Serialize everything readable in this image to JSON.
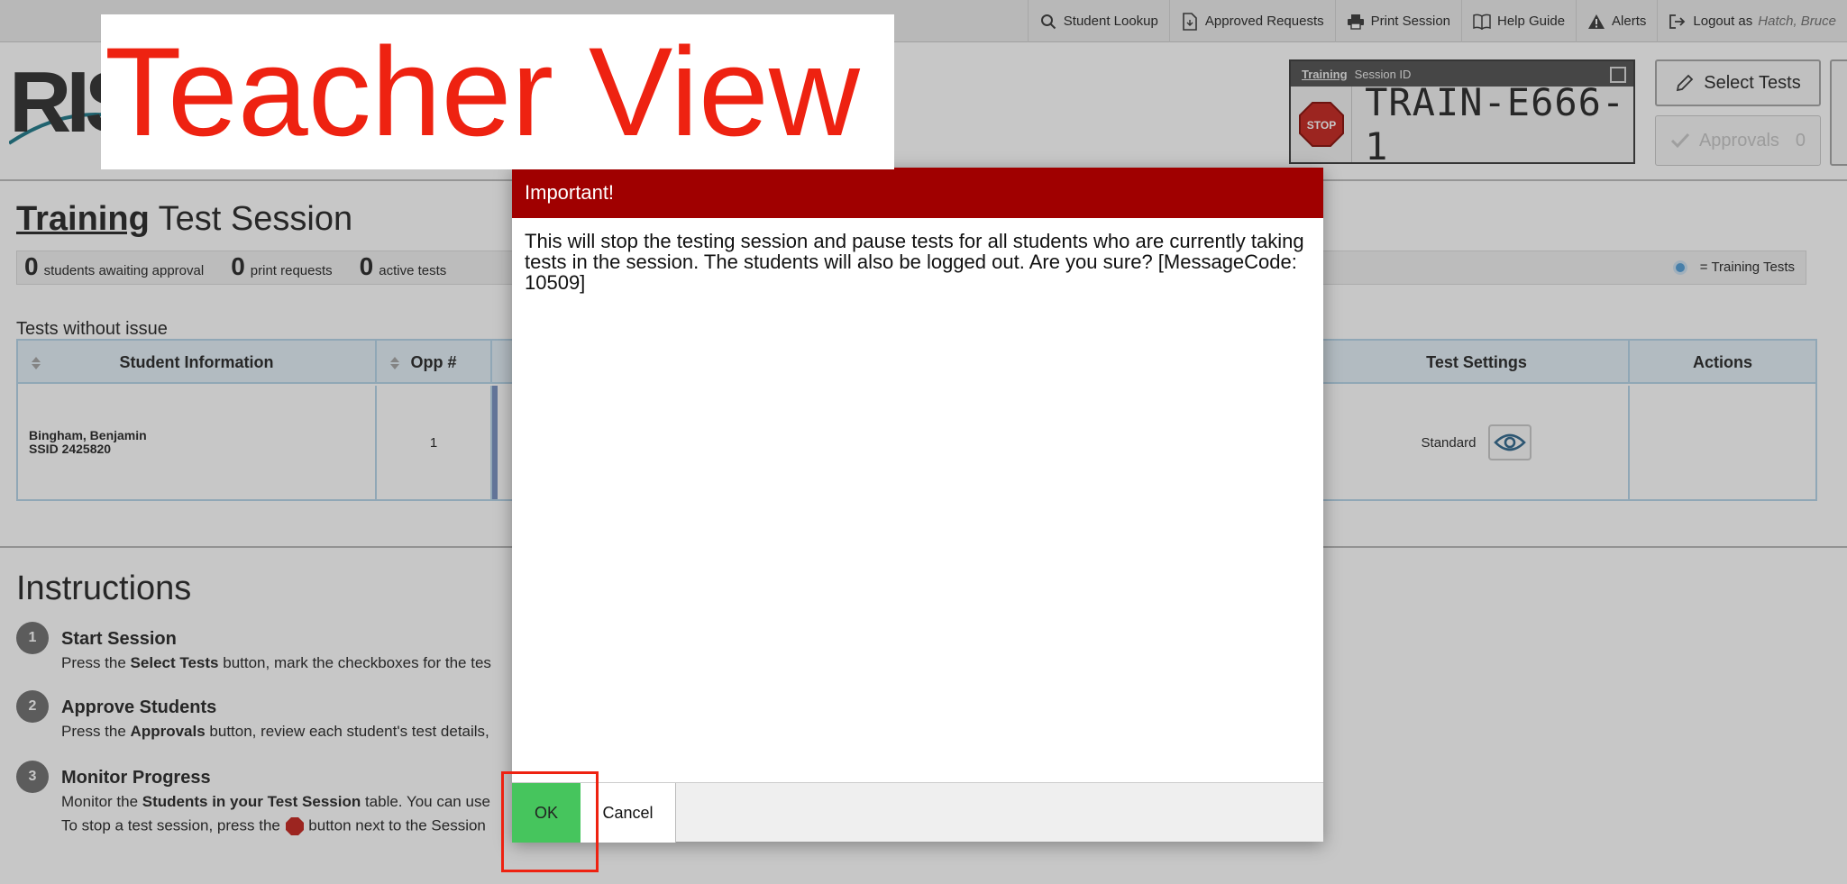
{
  "topnav": {
    "items": [
      {
        "label": "Student Lookup",
        "icon": "search-icon"
      },
      {
        "label": "Approved Requests",
        "icon": "document-icon"
      },
      {
        "label": "Print Session",
        "icon": "printer-icon"
      },
      {
        "label": "Help Guide",
        "icon": "book-icon"
      },
      {
        "label": "Alerts",
        "icon": "warning-icon"
      }
    ],
    "logout_label": "Logout as",
    "user_name": "Hatch, Bruce"
  },
  "header": {
    "logo_text": "RIS",
    "overlay_caption": "Teacher View",
    "session_mode": "Training",
    "session_label": "Session ID",
    "session_id": "TRAIN-E666-1",
    "stop_label": "STOP",
    "select_tests_label": "Select Tests",
    "approvals_label": "Approvals",
    "approvals_count": "0"
  },
  "page": {
    "title_prefix": "Training",
    "title_rest": "Test Session",
    "counters": [
      {
        "count": "0",
        "label": "students awaiting approval"
      },
      {
        "count": "0",
        "label": "print requests"
      },
      {
        "count": "0",
        "label": "active tests"
      }
    ],
    "legend_label": "= Training Tests",
    "section_label": "Tests without issue",
    "table": {
      "headers": [
        "Student Information",
        "Opp #",
        "Test Settings",
        "Actions"
      ],
      "row": {
        "student_name": "Bingham, Benjamin",
        "ssid": "SSID 2425820",
        "opp": "1",
        "settings": "Standard"
      }
    }
  },
  "instructions": {
    "title": "Instructions",
    "steps": [
      {
        "num": "1",
        "title": "Start Session",
        "pre": "Press the ",
        "bold": "Select Tests",
        "post": " button, mark the checkboxes for the tes"
      },
      {
        "num": "2",
        "title": "Approve Students",
        "pre": "Press the ",
        "bold": "Approvals",
        "post": " button, review each student's test details,"
      },
      {
        "num": "3",
        "title": "Monitor Progress",
        "pre": "Monitor the ",
        "bold": "Students in your Test Session",
        "post": " table. You can use",
        "line2_pre": "To stop a test session, press the ",
        "line2_post": " button next to the Session"
      }
    ]
  },
  "modal": {
    "title": "Important!",
    "message": "This will stop the testing session and pause tests for all students who are currently taking tests in the session. The students will also be logged out. Are you sure? [MessageCode: 10509]",
    "ok_label": "OK",
    "cancel_label": "Cancel"
  },
  "colors": {
    "modal_header": "#a00000",
    "ok_button": "#46c55d",
    "annotation_red": "#ee2211",
    "legend_dot": "#5ba3d9"
  }
}
